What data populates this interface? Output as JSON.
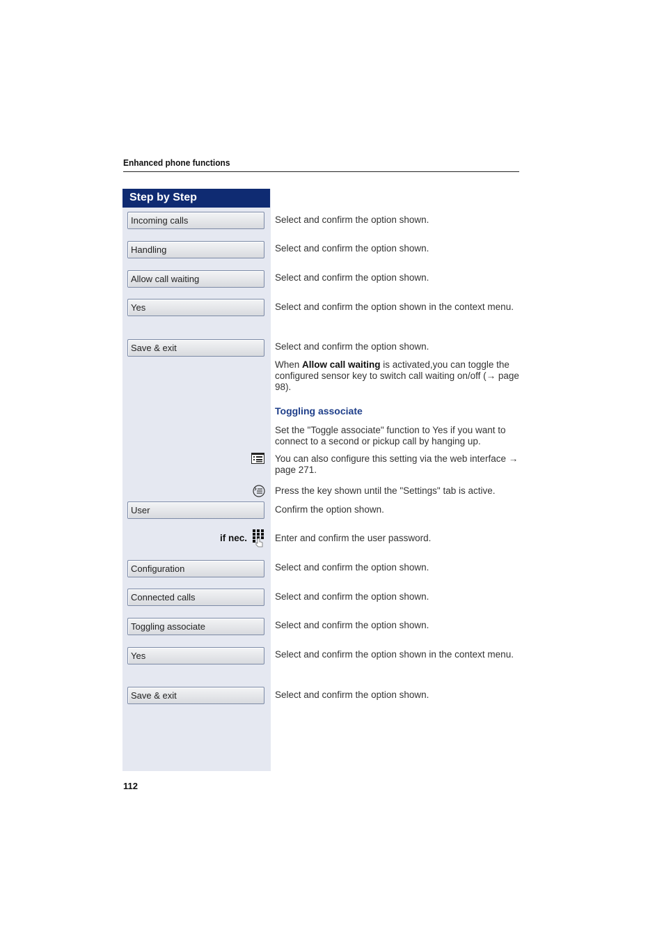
{
  "header": {
    "title": "Enhanced phone functions"
  },
  "sidebar": {
    "title": "Step by Step"
  },
  "steps": [
    {
      "button": "Incoming calls",
      "text": "Select and confirm the option shown."
    },
    {
      "button": "Handling",
      "text": "Select and confirm the option shown."
    },
    {
      "button": "Allow call waiting",
      "text": "Select and confirm the option shown."
    },
    {
      "button": "Yes",
      "text": "Select and confirm the option shown in the context menu."
    },
    {
      "button": "Save & exit",
      "text": "Select and confirm the option shown."
    }
  ],
  "note": {
    "pre": "When ",
    "bold": "Allow call waiting",
    "post": " is activated,you can toggle the configured sensor key to switch call waiting on/off (→ page 98)."
  },
  "section": {
    "title": "Toggling associate",
    "intro": "Set the \"Toggle associate\" function to Yes if you want to connect to a second or pickup call by hanging up.",
    "web_note": "You can also configure this setting via the web interface → page 271.",
    "key_note": "Press the key shown until the \"Settings\" tab is active.",
    "if_nec": "if nec.",
    "password_note": "Enter and confirm the user password."
  },
  "steps2": [
    {
      "button": "User",
      "text": "Confirm the option shown."
    },
    {
      "button": "Configuration",
      "text": "Select and confirm the option shown."
    },
    {
      "button": "Connected calls",
      "text": "Select and confirm the option shown."
    },
    {
      "button": "Toggling associate",
      "text": "Select and confirm the option shown."
    },
    {
      "button": "Yes",
      "text": "Select and confirm the option shown in the context menu."
    },
    {
      "button": "Save & exit",
      "text": "Select and confirm the option shown."
    }
  ],
  "footer": {
    "page_number": "112"
  }
}
